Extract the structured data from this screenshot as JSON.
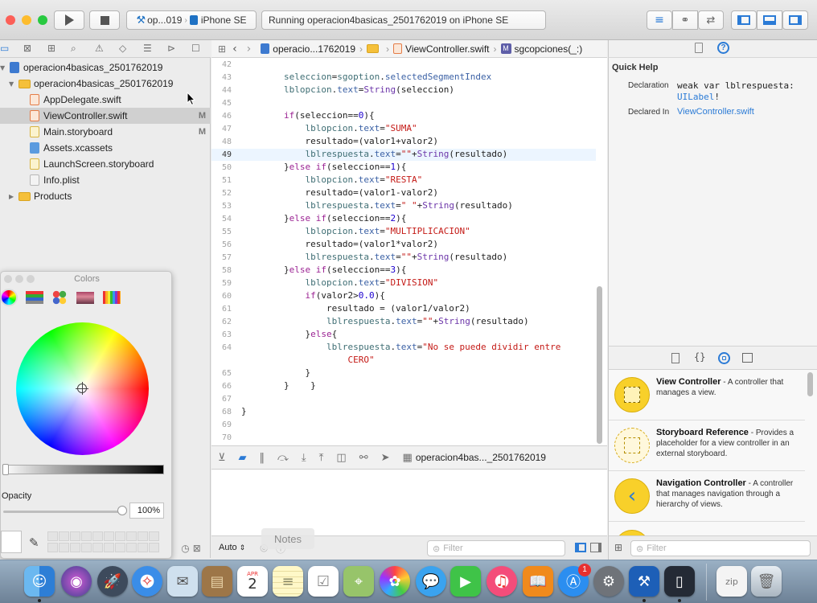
{
  "toolbar": {
    "scheme_target": "op...019",
    "device": "iPhone SE",
    "status": "Running operacion4basicas_2501762019 on iPhone SE",
    "colors": {
      "close": "#fc5f57",
      "minimize": "#fdbc2e",
      "zoom": "#28c940",
      "accent": "#2b7bd6"
    }
  },
  "navigator": {
    "items": [
      {
        "label": "operacion4basicas_2501762019",
        "kind": "project"
      },
      {
        "label": "operacion4basicas_2501762019",
        "kind": "folder"
      },
      {
        "label": "AppDelegate.swift",
        "kind": "swift",
        "mark": ""
      },
      {
        "label": "ViewController.swift",
        "kind": "swift",
        "mark": "M"
      },
      {
        "label": "Main.storyboard",
        "kind": "storyboard",
        "mark": "M"
      },
      {
        "label": "Assets.xcassets",
        "kind": "assets"
      },
      {
        "label": "LaunchScreen.storyboard",
        "kind": "storyboard"
      },
      {
        "label": "Info.plist",
        "kind": "plist"
      },
      {
        "label": "Products",
        "kind": "folder"
      }
    ]
  },
  "jumpbar": {
    "project": "operacio...1762019",
    "file": "ViewController.swift",
    "method_badge": "M",
    "method": "sgcopciones(_:)"
  },
  "editor": {
    "line_numbers": [
      "42",
      "43",
      "44",
      "45",
      "46",
      "47",
      "48",
      "49",
      "50",
      "51",
      "52",
      "53",
      "54",
      "55",
      "56",
      "57",
      "58",
      "59",
      "60",
      "61",
      "62",
      "63",
      "64",
      "",
      "65",
      "66",
      "67",
      "68",
      "69",
      "70"
    ],
    "current_line": "49"
  },
  "debugbar": {
    "process": "operacion4bas..._2501762019"
  },
  "console": {
    "mode": "Auto",
    "filter_placeholder": "Filter"
  },
  "quick_help": {
    "title": "Quick Help",
    "declaration_label": "Declaration",
    "declaration_line1": "weak var lblrespuesta:",
    "declaration_type": "UILabel",
    "declaration_suffix": "!",
    "declared_in_label": "Declared In",
    "declared_in": "ViewController.swift"
  },
  "library": {
    "items": [
      {
        "title": "View Controller",
        "desc": "A controller that manages a view."
      },
      {
        "title": "Storyboard Reference",
        "desc": "Provides a placeholder for a view controller in an external storyboard."
      },
      {
        "title": "Navigation Controller",
        "desc": "A controller that manages navigation through a hierarchy of views."
      }
    ],
    "filter_placeholder": "Filter"
  },
  "colors_panel": {
    "title": "Colors",
    "opacity_label": "Opacity",
    "opacity_value": "100%",
    "opacity": 1.0
  },
  "notes": "Notes",
  "dock": {
    "calendar_month": "APR",
    "calendar_day": "2",
    "appstore_badge": "1"
  }
}
